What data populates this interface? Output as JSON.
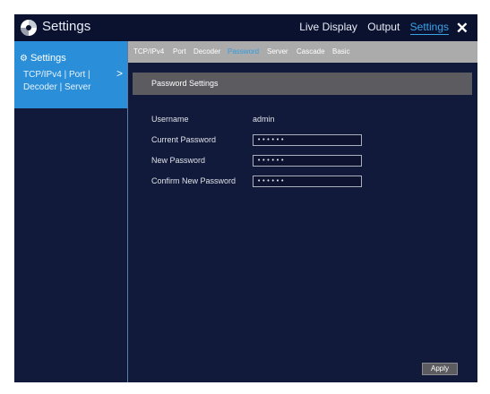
{
  "app": {
    "title": "Settings"
  },
  "topnav": {
    "items": [
      "Live Display",
      "Output",
      "Settings"
    ],
    "active": "Settings",
    "close_glyph": "✕"
  },
  "sidebar": {
    "heading": "Settings",
    "item_line1": "TCP/IPv4 | Port |",
    "item_line2": "Decoder | Server",
    "chevron": ">"
  },
  "tabs": [
    {
      "label": "TCP/IPv4",
      "active": false
    },
    {
      "label": "Port",
      "active": false
    },
    {
      "label": "Decoder",
      "active": false
    },
    {
      "label": "Password",
      "active": true
    },
    {
      "label": "Server",
      "active": false
    },
    {
      "label": "Cascade",
      "active": false
    },
    {
      "label": "Basic",
      "active": false
    }
  ],
  "section": {
    "title": "Password Settings"
  },
  "form": {
    "username_label": "Username",
    "username_value": "admin",
    "current_label": "Current Password",
    "current_value": "••••••",
    "new_label": "New Password",
    "new_value": "••••••",
    "confirm_label": "Confirm New Password",
    "confirm_value": "••••••"
  },
  "actions": {
    "apply": "Apply"
  },
  "colors": {
    "accent": "#2f9ce0",
    "background": "#111a3a",
    "panel": "#2a8fd8",
    "tabbar": "#ababab"
  }
}
